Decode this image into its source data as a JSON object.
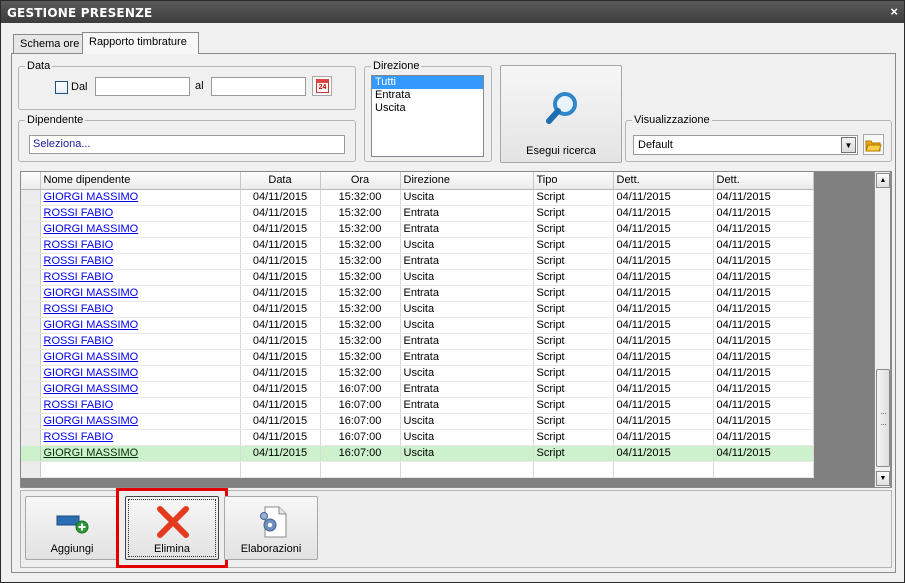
{
  "window": {
    "title": "GESTIONE PRESENZE",
    "close_glyph": "×"
  },
  "tabs": [
    {
      "label": "Schema ore"
    },
    {
      "label": "Rapporto timbrature"
    }
  ],
  "data_group": {
    "legend": "Data",
    "dal_label": "Dal",
    "dal_checked": false,
    "dal_value": "",
    "al_label": "al",
    "al_value": "",
    "calendar_text": "24",
    "calendar_icon": "calendar-icon"
  },
  "direzione_group": {
    "legend": "Direzione",
    "options": [
      "Tutti",
      "Entrata",
      "Uscita"
    ],
    "selected": "Tutti"
  },
  "search_button": {
    "label": "Esegui ricerca",
    "icon": "magnifier-icon"
  },
  "dipendente_group": {
    "legend": "Dipendente",
    "value": "Seleziona..."
  },
  "visualizzazione_group": {
    "legend": "Visualizzazione",
    "selected": "Default",
    "folder_icon": "folder-icon"
  },
  "grid": {
    "columns": [
      "Nome dipendente",
      "Data",
      "Ora",
      "Direzione",
      "Tipo",
      "Dett.",
      "Dett."
    ],
    "rows": [
      [
        "GIORGI MASSIMO",
        "04/11/2015",
        "15:32:00",
        "Uscita",
        "Script",
        "04/11/2015",
        "04/11/2015"
      ],
      [
        "ROSSI FABIO",
        "04/11/2015",
        "15:32:00",
        "Entrata",
        "Script",
        "04/11/2015",
        "04/11/2015"
      ],
      [
        "GIORGI MASSIMO",
        "04/11/2015",
        "15:32:00",
        "Entrata",
        "Script",
        "04/11/2015",
        "04/11/2015"
      ],
      [
        "ROSSI FABIO",
        "04/11/2015",
        "15:32:00",
        "Uscita",
        "Script",
        "04/11/2015",
        "04/11/2015"
      ],
      [
        "ROSSI FABIO",
        "04/11/2015",
        "15:32:00",
        "Entrata",
        "Script",
        "04/11/2015",
        "04/11/2015"
      ],
      [
        "ROSSI FABIO",
        "04/11/2015",
        "15:32:00",
        "Uscita",
        "Script",
        "04/11/2015",
        "04/11/2015"
      ],
      [
        "GIORGI MASSIMO",
        "04/11/2015",
        "15:32:00",
        "Entrata",
        "Script",
        "04/11/2015",
        "04/11/2015"
      ],
      [
        "ROSSI FABIO",
        "04/11/2015",
        "15:32:00",
        "Uscita",
        "Script",
        "04/11/2015",
        "04/11/2015"
      ],
      [
        "GIORGI MASSIMO",
        "04/11/2015",
        "15:32:00",
        "Uscita",
        "Script",
        "04/11/2015",
        "04/11/2015"
      ],
      [
        "ROSSI FABIO",
        "04/11/2015",
        "15:32:00",
        "Entrata",
        "Script",
        "04/11/2015",
        "04/11/2015"
      ],
      [
        "GIORGI MASSIMO",
        "04/11/2015",
        "15:32:00",
        "Entrata",
        "Script",
        "04/11/2015",
        "04/11/2015"
      ],
      [
        "GIORGI MASSIMO",
        "04/11/2015",
        "15:32:00",
        "Uscita",
        "Script",
        "04/11/2015",
        "04/11/2015"
      ],
      [
        "GIORGI MASSIMO",
        "04/11/2015",
        "16:07:00",
        "Entrata",
        "Script",
        "04/11/2015",
        "04/11/2015"
      ],
      [
        "ROSSI FABIO",
        "04/11/2015",
        "16:07:00",
        "Entrata",
        "Script",
        "04/11/2015",
        "04/11/2015"
      ],
      [
        "GIORGI MASSIMO",
        "04/11/2015",
        "16:07:00",
        "Uscita",
        "Script",
        "04/11/2015",
        "04/11/2015"
      ],
      [
        "ROSSI FABIO",
        "04/11/2015",
        "16:07:00",
        "Uscita",
        "Script",
        "04/11/2015",
        "04/11/2015"
      ],
      [
        "GIORGI MASSIMO",
        "04/11/2015",
        "16:07:00",
        "Uscita",
        "Script",
        "04/11/2015",
        "04/11/2015"
      ]
    ],
    "highlighted_row": 16,
    "highlight_color": "#ccf1cc",
    "link_color": "#0000ee"
  },
  "actions": [
    {
      "label": "Aggiungi",
      "icon": "add-item-icon"
    },
    {
      "label": "Elimina",
      "icon": "delete-x-icon"
    },
    {
      "label": "Elaborazioni",
      "icon": "document-gear-icon"
    }
  ],
  "emphasis_color": "#e00000"
}
